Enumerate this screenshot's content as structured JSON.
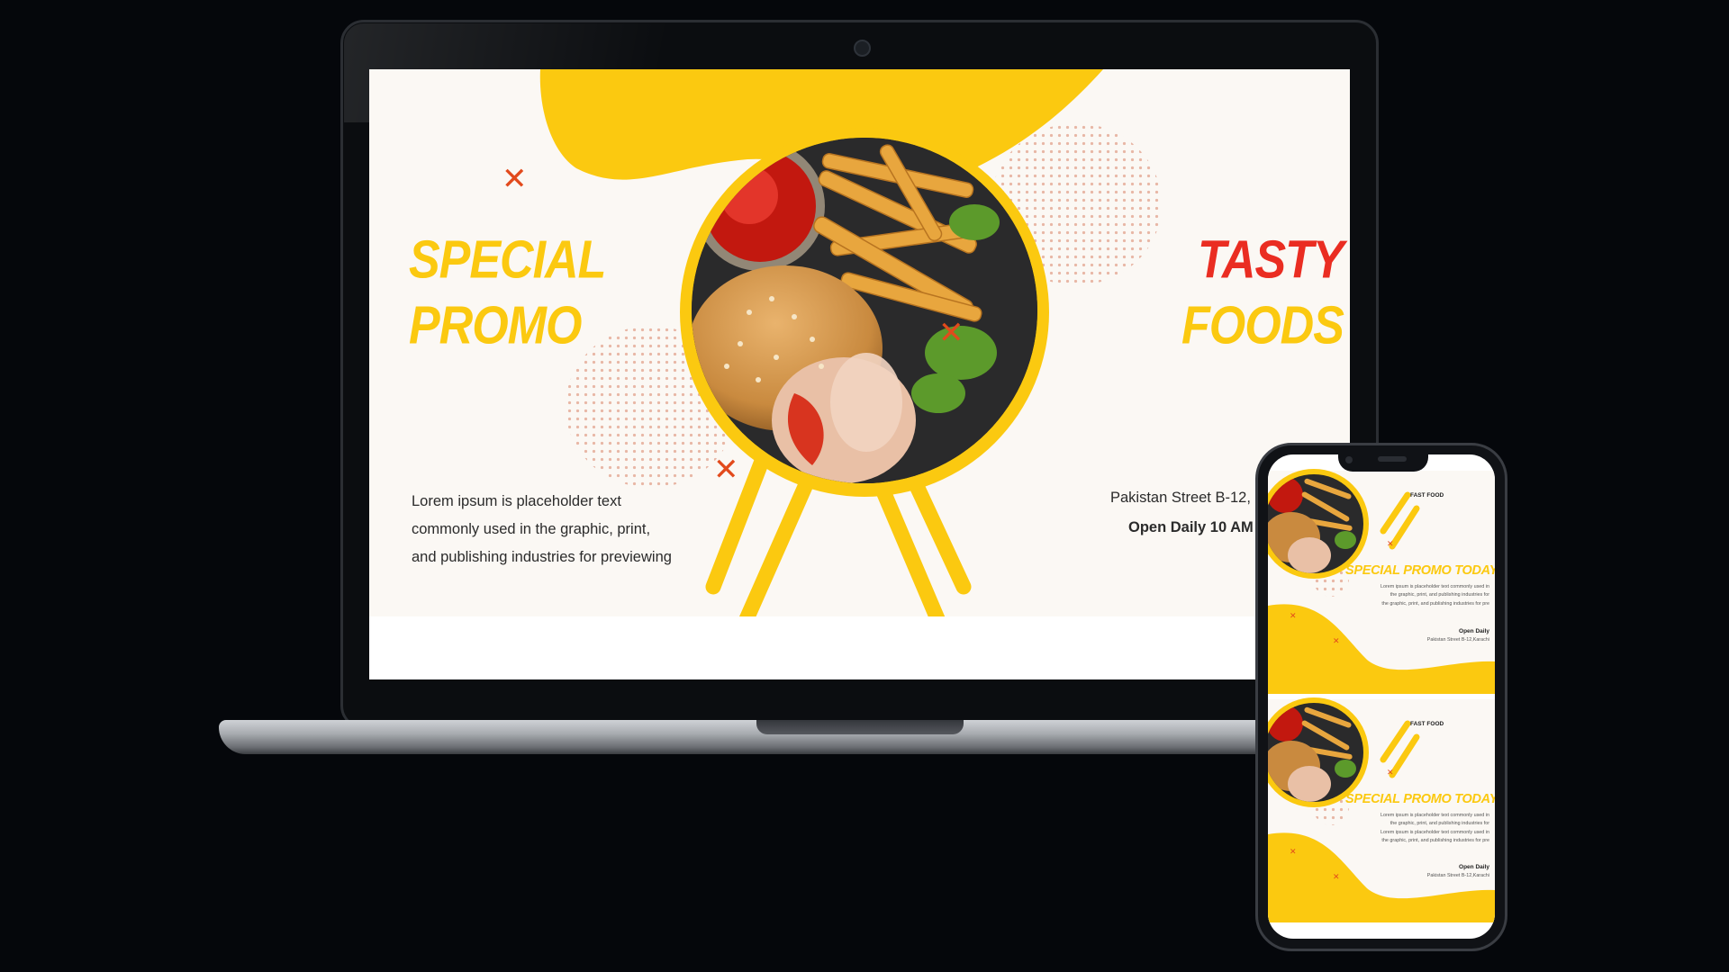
{
  "slide": {
    "left_title_line1": "SPECIAL",
    "left_title_line2": "PROMO",
    "right_title_line1": "TASTY",
    "right_title_line2": "FOODS",
    "body_line1": "Lorem ipsum is placeholder text",
    "body_line2": "commonly used in the graphic, print,",
    "body_line3": "and publishing industries for previewing",
    "address": "Pakistan Street B-12, K",
    "hours": "Open Daily 10 AM –",
    "x_icon": "✕"
  },
  "phone": {
    "card1": {
      "label": "FAST FOOD",
      "title": "SPECIAL PROMO TODAY",
      "text_line1": "Lorem ipsum is placeholder text commonly used in",
      "text_line2": "the graphic, print, and publishing industries for",
      "text_line3": "the graphic, print, and publishing industries for pre",
      "open": "Open Daily",
      "address": "Pakistan Street B-12,Karachi"
    },
    "card2": {
      "label": "FAST FOOD",
      "title": "SPECIAL PROMO TODAY",
      "text_line1": "Lorem ipsum is placeholder text commonly used in",
      "text_line2": "the graphic, print, and publishing industries for",
      "text_line3": "Lorem ipsum is placeholder text commonly used in",
      "text_line4": "the graphic, print, and publishing industries for pre",
      "open": "Open Daily",
      "address": "Pakistan Street B-12,Karachi"
    }
  },
  "colors": {
    "background": "#05070b",
    "accent_yellow": "#fbc910",
    "accent_red": "#ea2d22",
    "x_orange": "#e24a1c",
    "slide_bg": "#fbf8f4"
  }
}
